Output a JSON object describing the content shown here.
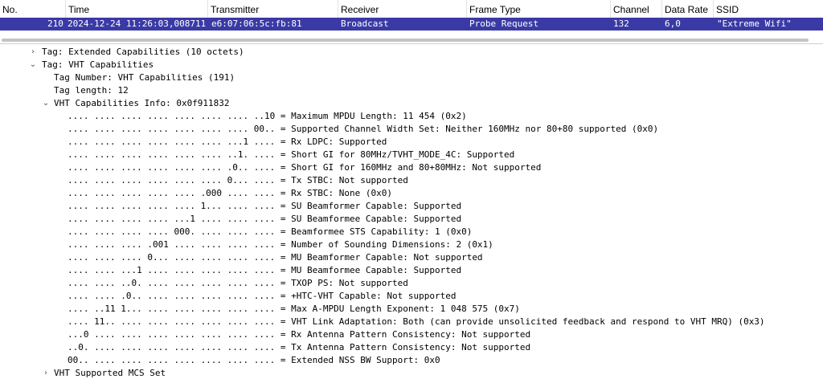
{
  "packet_list": {
    "columns": [
      "No.",
      "Time",
      "Transmitter",
      "Receiver",
      "Frame Type",
      "Channel",
      "Data Rate",
      "SSID"
    ],
    "selected_row": {
      "no": "210",
      "time": "2024-12-24 11:26:03,008711",
      "transmitter": "e6:07:06:5c:fb:81",
      "receiver": "Broadcast",
      "frame_type": "Probe Request",
      "channel": "132",
      "data_rate": "6,0",
      "ssid": "\"Extreme Wifi\""
    }
  },
  "details": {
    "ext_caps": "Tag: Extended Capabilities (10 octets)",
    "vht_caps": "Tag: VHT Capabilities",
    "tag_number": "Tag Number: VHT Capabilities (191)",
    "tag_length": "Tag length: 12",
    "info": "VHT Capabilities Info: 0x0f911832",
    "bits": [
      ".... .... .... .... .... .... .... ..10 = Maximum MPDU Length: 11 454 (0x2)",
      ".... .... .... .... .... .... .... 00.. = Supported Channel Width Set: Neither 160MHz nor 80+80 supported (0x0)",
      ".... .... .... .... .... .... ...1 .... = Rx LDPC: Supported",
      ".... .... .... .... .... .... ..1. .... = Short GI for 80MHz/TVHT_MODE_4C: Supported",
      ".... .... .... .... .... .... .0.. .... = Short GI for 160MHz and 80+80MHz: Not supported",
      ".... .... .... .... .... .... 0... .... = Tx STBC: Not supported",
      ".... .... .... .... .... .000 .... .... = Rx STBC: None (0x0)",
      ".... .... .... .... .... 1... .... .... = SU Beamformer Capable: Supported",
      ".... .... .... .... ...1 .... .... .... = SU Beamformee Capable: Supported",
      ".... .... .... .... 000. .... .... .... = Beamformee STS Capability: 1 (0x0)",
      ".... .... .... .001 .... .... .... .... = Number of Sounding Dimensions: 2 (0x1)",
      ".... .... .... 0... .... .... .... .... = MU Beamformer Capable: Not supported",
      ".... .... ...1 .... .... .... .... .... = MU Beamformee Capable: Supported",
      ".... .... ..0. .... .... .... .... .... = TXOP PS: Not supported",
      ".... .... .0.. .... .... .... .... .... = +HTC-VHT Capable: Not supported",
      ".... ..11 1... .... .... .... .... .... = Max A-MPDU Length Exponent: 1 048 575 (0x7)",
      ".... 11.. .... .... .... .... .... .... = VHT Link Adaptation: Both (can provide unsolicited feedback and respond to VHT MRQ) (0x3)",
      "...0 .... .... .... .... .... .... .... = Rx Antenna Pattern Consistency: Not supported",
      "..0. .... .... .... .... .... .... .... = Tx Antenna Pattern Consistency: Not supported",
      "00.. .... .... .... .... .... .... .... = Extended NSS BW Support: 0x0"
    ],
    "mcs_set": "VHT Supported MCS Set"
  },
  "icons": {
    "collapsed": "chevron-right-icon",
    "expanded": "chevron-down-icon"
  },
  "colors": {
    "selection": "#3a3aa6"
  }
}
